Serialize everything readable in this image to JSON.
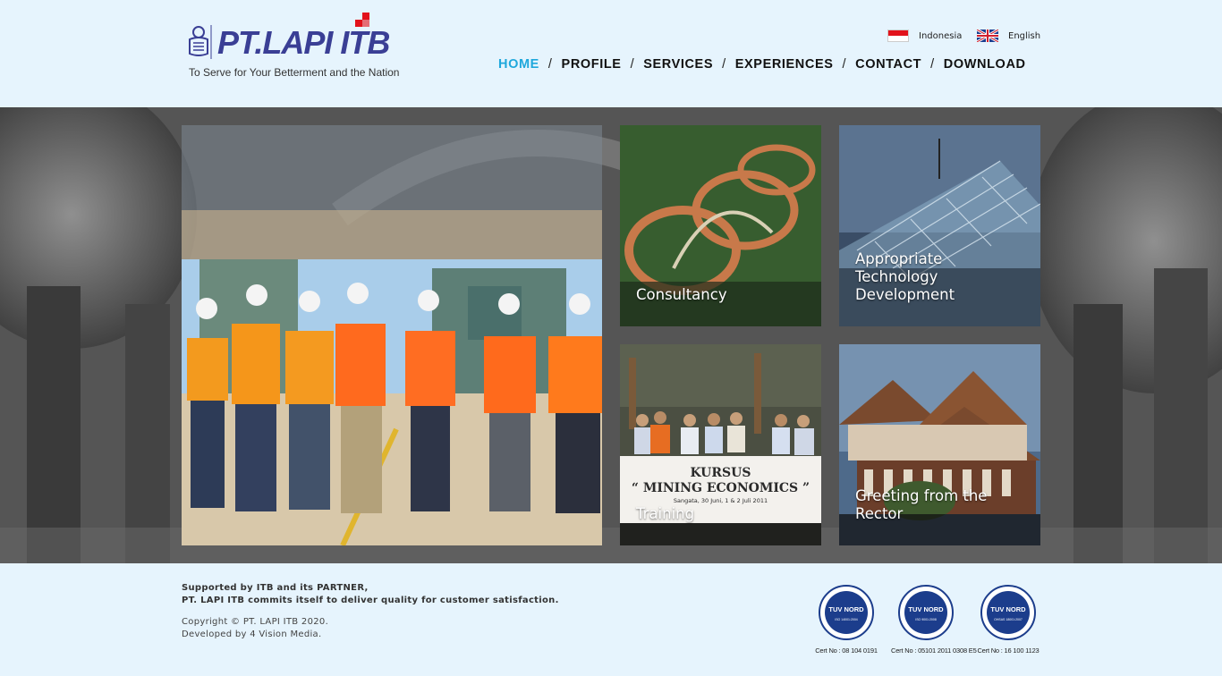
{
  "brand": {
    "name": "PT.LAPI ITB",
    "tagline": "To Serve for Your Betterment and the Nation"
  },
  "languages": [
    {
      "label": "Indonesia",
      "flag": "flag-indonesia-icon"
    },
    {
      "label": "English",
      "flag": "flag-uk-icon"
    }
  ],
  "nav": {
    "items": [
      {
        "label": "HOME",
        "active": true
      },
      {
        "label": "PROFILE"
      },
      {
        "label": "SERVICES"
      },
      {
        "label": "EXPERIENCES"
      },
      {
        "label": "CONTACT"
      },
      {
        "label": "DOWNLOAD"
      }
    ],
    "separator": "/",
    "active_color": "#1fa8dc"
  },
  "tiles": [
    {
      "label": "Consultancy"
    },
    {
      "label_lines": [
        "Appropriate",
        "Technology",
        "Development"
      ]
    },
    {
      "label": "Training",
      "banner_line1": "KURSUS",
      "banner_line2": "“ MINING ECONOMICS ”",
      "banner_line3": "Sangata, 30 Juni, 1 & 2 Juli 2011"
    },
    {
      "label_lines": [
        "Greeting from the",
        "Rector"
      ]
    }
  ],
  "footer": {
    "support_line1": "Supported by ITB and its PARTNER,",
    "support_line2": "PT. LAPI ITB commits itself to deliver quality for customer satisfaction.",
    "copyright": "Copyright © PT. LAPI ITB 2020.",
    "developer": "Developed by 4 Vision Media.",
    "certs": [
      {
        "badge": "TUV NORD",
        "standard": "ISO 14001:2004",
        "number": "Cert No : 08 104 0191"
      },
      {
        "badge": "TUV NORD",
        "standard": "ISO 9001:2008",
        "number": "Cert No : 05101 2011 0308 E5"
      },
      {
        "badge": "TUV NORD",
        "standard": "OHSAS 18001:2007",
        "number": "Cert No : 16 100 1123"
      }
    ]
  },
  "colors": {
    "page_bg": "#e6f4fd",
    "brand_blue": "#3a3f95",
    "brand_red": "#e2121b",
    "cert_blue": "#1c3d8c"
  }
}
